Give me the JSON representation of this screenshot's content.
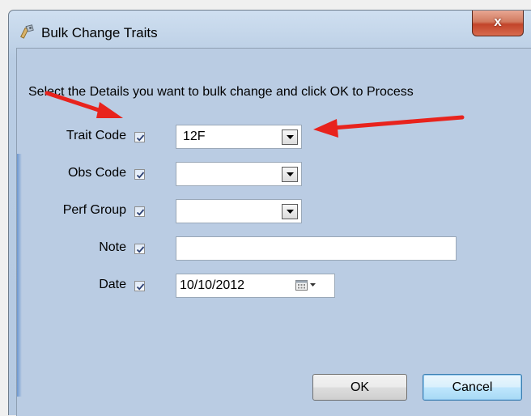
{
  "window": {
    "title": "Bulk Change Traits",
    "close_label": "x"
  },
  "instructions": "Select the Details you want to bulk change and click OK to Process",
  "fields": {
    "trait_code": {
      "label": "Trait Code",
      "checked": true,
      "value": "12F"
    },
    "obs_code": {
      "label": "Obs Code",
      "checked": true,
      "value": ""
    },
    "perf_group": {
      "label": "Perf Group",
      "checked": true,
      "value": ""
    },
    "note": {
      "label": "Note",
      "checked": true,
      "value": ""
    },
    "date": {
      "label": "Date",
      "checked": true,
      "value": "10/10/2012"
    }
  },
  "buttons": {
    "ok_label": "OK",
    "cancel_label": "Cancel"
  },
  "colors": {
    "annotation_arrow": "#e8231d",
    "dialog_background": "#bacce3"
  }
}
